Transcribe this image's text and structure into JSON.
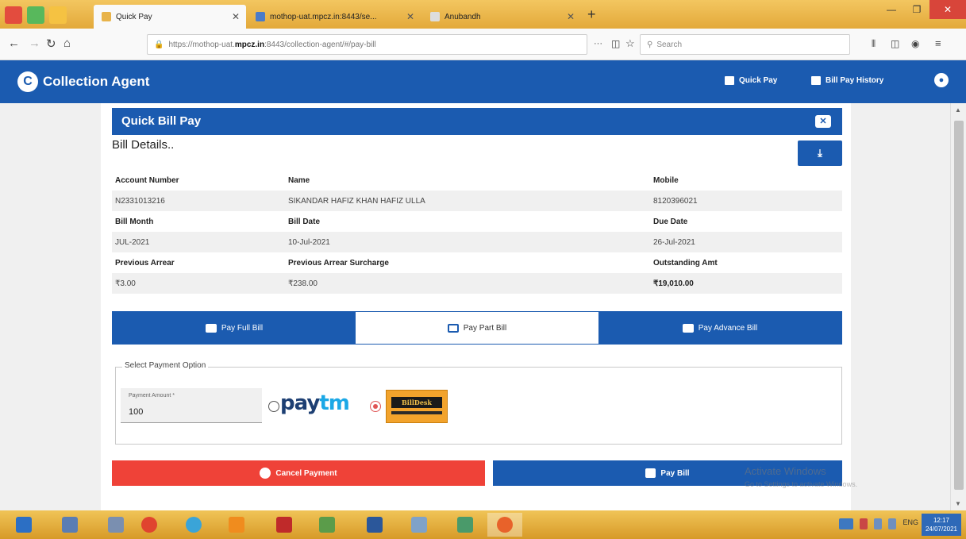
{
  "browser": {
    "tabs": [
      {
        "label": "Quick Pay",
        "active": true
      },
      {
        "label": "mothop-uat.mpcz.in:8443/se...",
        "active": false
      },
      {
        "label": "Anubandh",
        "active": false
      }
    ],
    "url_prefix": "https://mothop-uat.",
    "url_domain": "mpcz.in",
    "url_suffix": ":8443/collection-agent/#/pay-bill",
    "search_placeholder": "Search",
    "url_menu": "···"
  },
  "app": {
    "title": "Collection Agent",
    "nav": {
      "quick_pay": "Quick Pay",
      "bill_pay_history": "Bill Pay History"
    }
  },
  "card": {
    "header": "Quick Bill Pay",
    "section_title": "Bill Details..",
    "details": {
      "labels_row1": [
        "Account Number",
        "Name",
        "Mobile"
      ],
      "values_row1": [
        "N2331013216",
        "SIKANDAR HAFIZ KHAN HAFIZ ULLA",
        "8120396021"
      ],
      "labels_row2": [
        "Bill Month",
        "Bill Date",
        "Due Date"
      ],
      "values_row2": [
        "JUL-2021",
        "10-Jul-2021",
        "26-Jul-2021"
      ],
      "labels_row3": [
        "Previous Arrear",
        "Previous Arrear Surcharge",
        "Outstanding Amt"
      ],
      "values_row3": [
        "₹3.00",
        "₹238.00",
        "₹19,010.00"
      ]
    },
    "pay_tabs": {
      "full": "Pay Full Bill",
      "part": "Pay Part Bill",
      "advance": "Pay Advance Bill",
      "selected": "part"
    },
    "payment_option": {
      "legend": "Select Payment Option",
      "amount_label": "Payment Amount *",
      "amount_value": "100",
      "paytm_a": "pay",
      "paytm_b": "tm",
      "billdesk": "BillDesk",
      "selected_gateway": "billdesk"
    },
    "buttons": {
      "cancel": "Cancel Payment",
      "pay": "Pay Bill"
    }
  },
  "watermark": {
    "line1": "Activate Windows",
    "line2": "Go to Settings to activate Windows."
  },
  "taskbar": {
    "lang": "ENG",
    "time": "12:17",
    "date": "24/07/2021"
  },
  "colors": {
    "primary": "#1b5bb0",
    "danger": "#ef4238",
    "taskbar": "#e3a93a"
  }
}
